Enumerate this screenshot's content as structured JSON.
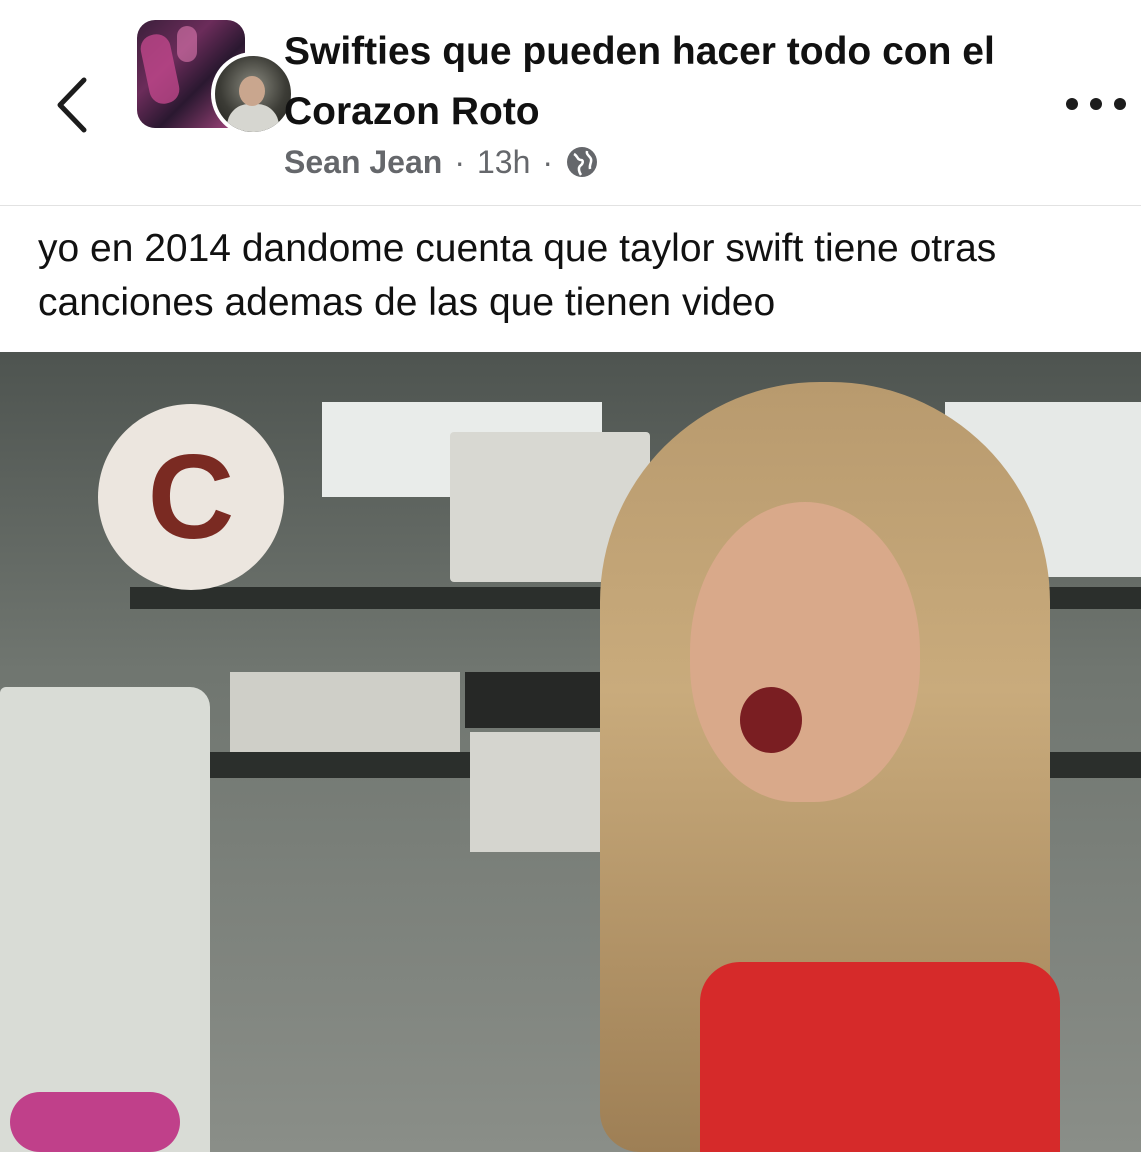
{
  "header": {
    "back_icon": "chevron-left-icon",
    "group_name": "Swifties que pueden hacer todo con el Corazon Roto",
    "author": "Sean Jean",
    "separator": "·",
    "time": "13h",
    "privacy_icon": "globe-icon",
    "more_icon": "more-options-icon"
  },
  "post": {
    "caption": "yo en 2014 dandome cuenta que taylor swift tiene otras canciones ademas de las que tienen video",
    "image_logo_letter": "C"
  }
}
